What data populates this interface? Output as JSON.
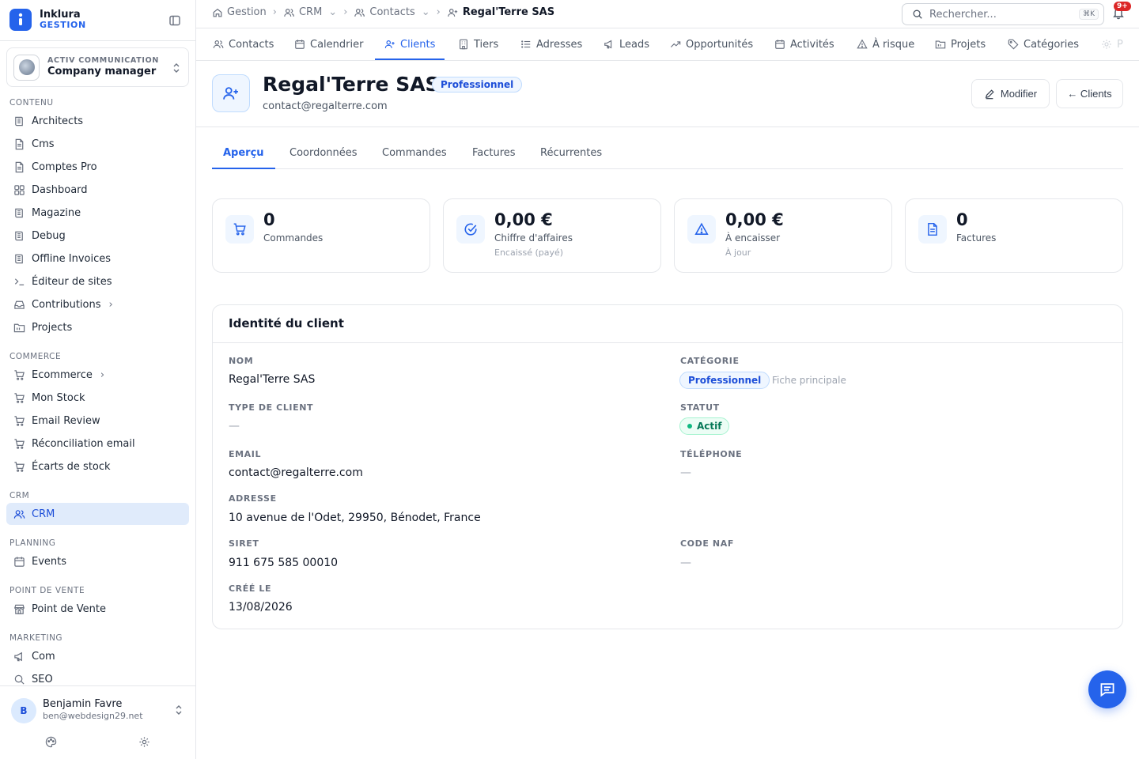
{
  "brand": {
    "name": "Inklura",
    "subtitle": "GESTION"
  },
  "org": {
    "name": "ACTIV COMMUNICATION",
    "role": "Company manager"
  },
  "sidebar": {
    "sections": [
      {
        "label": "CONTENU",
        "items": [
          {
            "label": "Architects",
            "icon": "book-icon"
          },
          {
            "label": "Cms",
            "icon": "document-icon"
          },
          {
            "label": "Comptes Pro",
            "icon": "document-icon"
          },
          {
            "label": "Dashboard",
            "icon": "grid-icon"
          },
          {
            "label": "Magazine",
            "icon": "book-icon"
          },
          {
            "label": "Debug",
            "icon": "book-icon"
          },
          {
            "label": "Offline Invoices",
            "icon": "book-icon"
          },
          {
            "label": "Éditeur de sites",
            "icon": "terminal-icon"
          },
          {
            "label": "Contributions",
            "icon": "inbox-icon",
            "expandable": true
          },
          {
            "label": "Projects",
            "icon": "folder-icon"
          }
        ]
      },
      {
        "label": "COMMERCE",
        "items": [
          {
            "label": "Ecommerce",
            "icon": "cart-icon",
            "expandable": true
          },
          {
            "label": "Mon Stock",
            "icon": "cart-icon"
          },
          {
            "label": "Email Review",
            "icon": "cart-icon"
          },
          {
            "label": "Réconciliation email",
            "icon": "cart-icon"
          },
          {
            "label": "Écarts de stock",
            "icon": "cart-icon"
          }
        ]
      },
      {
        "label": "CRM",
        "items": [
          {
            "label": "CRM",
            "icon": "users-icon",
            "active": true
          }
        ]
      },
      {
        "label": "PLANNING",
        "items": [
          {
            "label": "Events",
            "icon": "calendar-icon"
          }
        ]
      },
      {
        "label": "POINT DE VENTE",
        "items": [
          {
            "label": "Point de Vente",
            "icon": "store-icon"
          }
        ]
      },
      {
        "label": "MARKETING",
        "items": [
          {
            "label": "Com",
            "icon": "megaphone-icon"
          },
          {
            "label": "SEO",
            "icon": "search-icon"
          }
        ]
      }
    ]
  },
  "user": {
    "initial": "B",
    "name": "Benjamin Favre",
    "email": "ben@webdesign29.net"
  },
  "breadcrumb": [
    {
      "label": "Gestion",
      "icon": "home-icon"
    },
    {
      "label": "CRM",
      "icon": "users-icon",
      "dropdown": true
    },
    {
      "label": "Contacts",
      "icon": "users-icon",
      "dropdown": true
    },
    {
      "label": "Regal'Terre SAS",
      "icon": "user-plus-icon",
      "current": true
    }
  ],
  "search": {
    "placeholder": "Rechercher...",
    "shortcut": "⌘K"
  },
  "notifications": {
    "badge": "9+"
  },
  "module_tabs": [
    {
      "label": "Contacts",
      "icon": "users-icon"
    },
    {
      "label": "Calendrier",
      "icon": "calendar-icon"
    },
    {
      "label": "Clients",
      "icon": "user-plus-icon",
      "active": true
    },
    {
      "label": "Tiers",
      "icon": "building-icon"
    },
    {
      "label": "Adresses",
      "icon": "list-icon"
    },
    {
      "label": "Leads",
      "icon": "megaphone-icon"
    },
    {
      "label": "Opportunités",
      "icon": "trending-icon"
    },
    {
      "label": "Activités",
      "icon": "calendar-icon"
    },
    {
      "label": "À risque",
      "icon": "warning-icon"
    },
    {
      "label": "Projets",
      "icon": "folder-icon"
    },
    {
      "label": "Catégories",
      "icon": "tag-icon"
    },
    {
      "label": "P",
      "icon": "gear-icon"
    }
  ],
  "client": {
    "name": "Regal'Terre SAS",
    "badge": "Professionnel",
    "email": "contact@regalterre.com",
    "edit_label": "Modifier",
    "back_label": "← Clients"
  },
  "sub_tabs": [
    "Aperçu",
    "Coordonnées",
    "Commandes",
    "Factures",
    "Récurrentes"
  ],
  "stats": [
    {
      "value": "0",
      "label": "Commandes",
      "sub": "",
      "icon": "cart-icon"
    },
    {
      "value": "0,00 €",
      "label": "Chiffre d'affaires",
      "sub": "Encaissé (payé)",
      "icon": "check-circle-icon"
    },
    {
      "value": "0,00 €",
      "label": "À encaisser",
      "sub": "À jour",
      "icon": "warning-icon"
    },
    {
      "value": "0",
      "label": "Factures",
      "sub": "",
      "icon": "file-icon"
    }
  ],
  "identity": {
    "title": "Identité du client",
    "nom_label": "NOM",
    "nom_value": "Regal'Terre SAS",
    "categorie_label": "CATÉGORIE",
    "categorie_value": "Professionnel",
    "categorie_note": "Fiche principale",
    "type_label": "TYPE DE CLIENT",
    "type_value": "—",
    "statut_label": "STATUT",
    "statut_value": "Actif",
    "email_label": "EMAIL",
    "email_value": "contact@regalterre.com",
    "telephone_label": "TÉLÉPHONE",
    "telephone_value": "—",
    "adresse_label": "ADRESSE",
    "adresse_value": "10 avenue de l'Odet, 29950, Bénodet, France",
    "siret_label": "SIRET",
    "siret_value": "911 675 585 00010",
    "naf_label": "CODE NAF",
    "naf_value": "—",
    "cree_label": "CRÉÉ LE",
    "cree_value": "13/08/2026"
  },
  "colors": {
    "accent": "#2563eb",
    "active_bg": "#e0ebfb",
    "success": "#10b981",
    "danger": "#dc2626"
  }
}
